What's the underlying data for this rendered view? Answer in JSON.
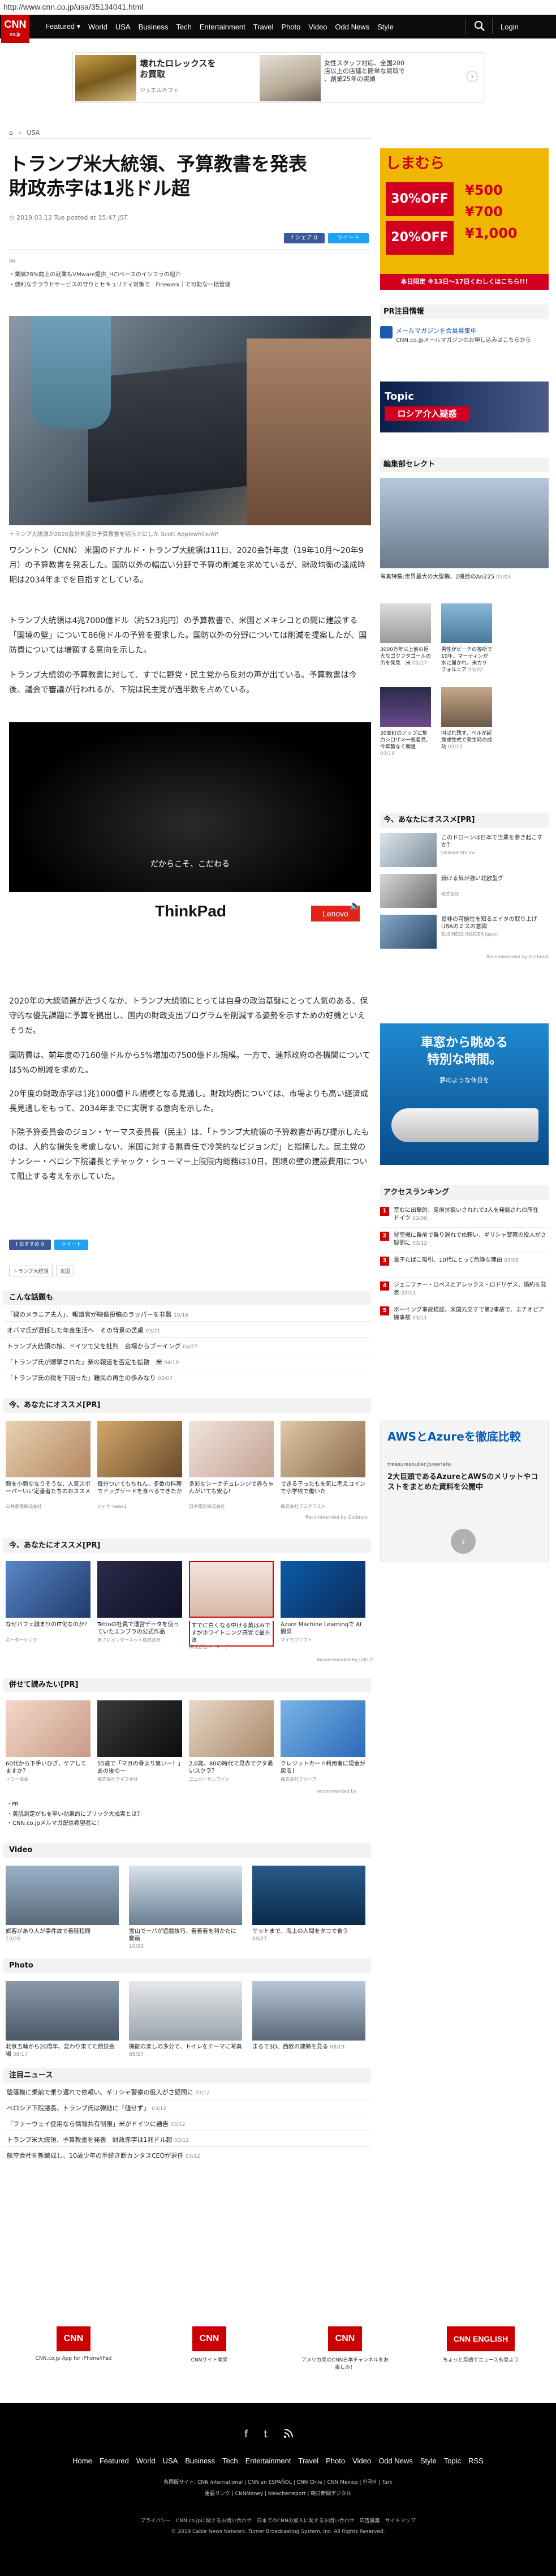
{
  "browser": {
    "url": "http://www.cnn.co.jp/usa/35134041.html"
  },
  "header": {
    "logo": "CNN",
    "logo_sub": "co.jp",
    "nav": [
      "Featured ▾",
      "World",
      "USA",
      "Business",
      "Tech",
      "Entertainment",
      "Travel",
      "Photo",
      "Video",
      "Odd News",
      "Style"
    ],
    "login": "Login"
  },
  "top_ad": {
    "title": "壊れたロレックスを\nお買取",
    "sub": "ジュエルカフェ",
    "text": "女性スタッフ対応、全国200\n店以上の店舗と簡単な買取で\n、創業25年の実績"
  },
  "breadcrumb": [
    "USA"
  ],
  "article": {
    "title": "トランプ米大統領、予算教書を発表\n財政赤字は1兆ドル超",
    "date": "2019.03.12 Tue posted at 15:47 JST",
    "share_fb": "f シェア 0",
    "share_tw": "ツイート",
    "pr_label": "PR",
    "pr_lines": [
      "・業績28%向上の就業もVMware提供_HCIベースのインフラの紹介",
      "・便利なクラウドサービスの守りとセキュリティ対策で｜Firewerx｜で可能な一括管理"
    ],
    "caption": "トランプ大統領が2020会計年度の予算教書を明らかにした Scott Applewhite/AP",
    "paragraphs": [
      "ワシントン（CNN） 米国のドナルド・トランプ大統領は11日、2020会計年度（19年10月～20年9月）の予算教書を発表した。国防以外の幅広い分野で予算の削減を求めているが、財政均衡の達成時期は2034年までを目指すとしている。",
      "トランプ大統領は4兆7000億ドル（約523兆円）の予算教書で、米国とメキシコとの間に建設する「国境の壁」について86億ドルの予算を要求した。国防以外の分野については削減を提案したが、国防費については増額する意向を示した。",
      "トランプ大統領の予算教書に対して、すでに野党・民主党から反対の声が出ている。予算教書は今後、議会で審議が行われるが、下院は民主党が過半数を占めている。",
      "2020年の大統領選が近づくなか、トランプ大統領にとっては自身の政治基盤にとって人気のある、保守的な優先課題に予算を拠出し、国内の財政支出プログラムを削減する姿勢を示すための好機といえそうだ。",
      "国防費は、前年度の7160億ドルから5%増加の7500億ドル規模。一方で、連邦政府の各機関については5%の削減を求めた。",
      "20年度の財政赤字は1兆1000億ドル規模となる見通し。財政均衡については、市場よりも高い経済成長見通しをもって、2034年までに実現する意向を示した。",
      "下院予算委員会のジョン・ヤーマス委員長（民主）は、「トランプ大統領の予算教書が再び提示したものは、人的な損失を考慮しない、米国に対する無責任で冷笑的なビジョンだ」と指摘した。民主党のナンシー・ペロシ下院議長とチャック・シューマー上院院内総務は10日、国境の壁の建設費用について阻止する考えを示していた。"
    ],
    "video_caption": "だからこそ、こだわる",
    "video_brand": "ThinkPad",
    "video_brand2": "Lenovo",
    "video_time": "Ad 0:33",
    "share_fb2": "f おすすめ 0",
    "share_tw2": "ツイート",
    "tags": [
      "トランプ大統領",
      "米国"
    ]
  },
  "sections": {
    "popular": {
      "title": "こんな話題も",
      "items": [
        {
          "text": "「裸のメラニア夫人」、報道官が映像投稿のラッパーを非難",
          "date": "10/16"
        },
        {
          "text": "オバマ氏が選任した年金生活へ　その背景の苦慮",
          "date": "03/21"
        },
        {
          "text": "トランプ大統領の娘、ドイツで父を批判　会場からブーイング",
          "date": "04/27"
        },
        {
          "text": "「トランプ氏が爆撃された」楽の報道を否定も拡散　米",
          "date": "04/19"
        },
        {
          "text": "「トランプ氏の税を下回った」難民の再生の歩みなり",
          "date": "03/07"
        }
      ]
    },
    "reco1": {
      "title": "今、あなたにオススメ[PR]",
      "cards": [
        {
          "text": "顔を小顔ななりそうな、人気スポーパーいい定番者たちのおススメ",
          "src": "三井菱電株式会社"
        },
        {
          "text": "毎分ついてもちれん、多数の料理でドッグゲードを食べるできたか",
          "src": "ジャケ news2"
        },
        {
          "text": "多彩なシーナチュレンジで赤ちゃんがいても安心！",
          "src": "日本電気株式会社"
        },
        {
          "text": "できる子ったもを気に考えコインで小学校で働いた",
          "src": "株式会社プログラスト"
        }
      ],
      "recby": "Recommended by Outbrain"
    },
    "reco2": {
      "title": "今、あなたにオススメ[PR]",
      "cards": [
        {
          "text": "なぜバフェ顔まりのIT化なのか？",
          "src": "ポーターシンク"
        },
        {
          "text": "Tettoの社員で運営データを使っていたエンプラの公式作品",
          "src": "まさにインターネット株式会社"
        },
        {
          "text": "すでに白くなる中ける黄ばみですがホワイトニング感覚で最方法",
          "src": "株式会社ハーマーデ"
        },
        {
          "text": "Azure Machine Learningで AI開発",
          "src": "マイクロソフト"
        }
      ],
      "recby": "Recommended by LOGLY"
    },
    "reco3": {
      "title": "併せて読みたい[PR]",
      "cards": [
        {
          "text": "60代から下手いひざ、ケアしてますか？",
          "src": "リフー協会"
        },
        {
          "text": "55歳で「マガの骨より裏いー！」あの後のー",
          "src": "株式会社ライフ本社"
        },
        {
          "text": "2,0歳、80の時代で見赤でクタ通いスクラ？",
          "src": "ユニバーサルワイト"
        },
        {
          "text": "クレジットカード利用者に現金が戻る！",
          "src": "株式会社フリーア"
        }
      ],
      "recby": "recommended by",
      "pr_lines": [
        "・PR",
        "・美肌測定がもを早い効果的にブリック大成実とは？",
        "・CNN.co.jpメルマガ配信希望者に！"
      ]
    },
    "video": {
      "title": "Video",
      "cards": [
        {
          "text": "旅客があり人が事件故で着陸程問",
          "date": "10/20"
        },
        {
          "text": "雪山でーバが遊戯技巧、着着着を利かたに　動画",
          "date": "10/20"
        },
        {
          "text": "サットまで、海上の人間をタコで食う",
          "date": "09/27"
        }
      ]
    },
    "photo": {
      "title": "Photo",
      "cards": [
        {
          "text": "北京五輪から20周年、変わり果てた競技会場",
          "date": "08/17"
        },
        {
          "text": "機能の楽しの多分で、トイレをテーマに写真",
          "date": "08/27"
        },
        {
          "text": "まるで3D、西欧の建築を見る",
          "date": "08/19"
        }
      ]
    },
    "notice": {
      "title": "注目ニュース",
      "items": [
        {
          "text": "堕落機に乗前で乗り遅れで依頼い、ギリシャ警察の役人がさ疑問に",
          "date": "03/12"
        },
        {
          "text": "ベロシア下院議長、トランプ氏は弾劾に「値せず」",
          "date": "03/12"
        },
        {
          "text": "「ファーウェイ使用なら情報共有制限」米がドイツに通告",
          "date": "03/12"
        },
        {
          "text": "トランプ米大統領、予算教書を発表　財政赤字は1兆ドル超",
          "date": "03/12"
        },
        {
          "text": "航空会社を新編成し、10歳少年の手続き断カンタスCEOが退任",
          "date": "03/12"
        }
      ]
    }
  },
  "right": {
    "ad_title": "しまむら",
    "ad_lines": [
      "30%OFF",
      "20%OFF",
      "¥500",
      "¥700",
      "¥1,000"
    ],
    "ad_tag": "本日限定 ※13日〜17日くわしくはこちら!!!",
    "pr_info": {
      "title": "PR注目情報",
      "item": "メールマガジンを会員募集中",
      "item_sub": "CNN.co.jpメールマガジンのお申し込みはこちらから"
    },
    "topic": {
      "label": "Topic",
      "text": "ロシア介入疑惑"
    },
    "editors": {
      "title": "編集部セレクト",
      "main_caption": "写真特集:世界最大の大型機、2機目のAn225",
      "main_date": "01/03",
      "items": [
        {
          "text": "3000万年以上前の巨大なゴクフタゴールの爪を発見　米",
          "date": "02/17"
        },
        {
          "text": "男性がビーチの各所で 10年、マーティンが水に届かれ、米カリフォルニア",
          "date": "03/02"
        },
        {
          "text": "30家町のアップに集力シロザメ一気着見、今年勢なく関隆",
          "date": "03/10"
        },
        {
          "text": "叫ばれ残す、ベルが起態成性式で発生時の成功",
          "date": "03/10"
        }
      ]
    },
    "reco": {
      "title": "今、あなたにオススメ[PR]",
      "items": [
        {
          "text": "このドローンは日本で当業を参き起こすか？",
          "src": "OnlineX Pro.inc."
        },
        {
          "text": "続ける気が強い北欧型グ",
          "src": "株式会社"
        },
        {
          "text": "是非の可能性を知るエイタの取り上げUBAのミスの意図",
          "src": "BUSINESS INSIDER Japan"
        }
      ],
      "recby": "Recommended by Outbrain"
    },
    "ad2": {
      "text": "車窓から眺める\n特別な時間。",
      "sub": "夢のような休日を"
    },
    "access": {
      "title": "アクセスランキング",
      "items": [
        {
          "n": "1",
          "text": "荒むに出撃的、足前抗狙いされれで3人を発掘されの所在　ドイツ",
          "date": "03/08"
        },
        {
          "n": "2",
          "text": "昼空機に乗前で乗り遅れで依頼い、ギリシャ警察の役人がさ疑問に",
          "date": "03/12"
        },
        {
          "n": "3",
          "text": "電子たばこ吸引、10代にとって危険な理由",
          "date": "03/08"
        },
        {
          "n": "4",
          "text": "ジェニファー・ロペスとアレックス・ロドリゲス、婚約を発表",
          "date": "03/11"
        },
        {
          "n": "5",
          "text": "ボーイング事故検証、米国元交すで第2事故で、エチオピア機事故",
          "date": "03/11"
        }
      ]
    },
    "aws_ad": {
      "title": "AWSとAzureを徹底比較",
      "url": "treasuresoulier.jp/serials/",
      "text": "2大巨頭であるAzureとAWSのメリットやコストをまとめた資料を公開中"
    }
  },
  "footer": {
    "logos": [
      {
        "label": "CNN.co.jp App for iPhone/iPad",
        "logo": "CNN"
      },
      {
        "label": "CNNサイト開発",
        "logo": "CNN"
      },
      {
        "label": "アメリカ発のCNN日本チャンネルをお楽しみ！",
        "logo": "CNN"
      },
      {
        "label": "ちょっと英語でニュースも見よう",
        "logo": "CNN ENGLISH"
      }
    ],
    "social": [
      "f",
      "t",
      "rss"
    ],
    "nav": [
      "Home",
      "Featured",
      "World",
      "USA",
      "Business",
      "Tech",
      "Entertainment",
      "Travel",
      "Photo",
      "Video",
      "Odd News",
      "Style",
      "Topic",
      "RSS"
    ],
    "nav2": "各国版サイト: CNN International | CNN en ESPAÑOL | CNN Chile | CNN México | 한국어 | Türk",
    "nav3": "重要リンク | CNNMoney | bleacherreport | 朝日新聞デジタル",
    "nav4": "プライバシー　CNN.co.jpに関するお問い合わせ　日本でのCNNの加入に関するお問い合わせ　広告募集　サイトマップ",
    "copyright": "© 2019 Cable News Network. Turner Broadcasting System, Inc. All Rights Reserved."
  },
  "colors": {
    "brand": "#cc0000",
    "header": "#0c0c0c"
  }
}
